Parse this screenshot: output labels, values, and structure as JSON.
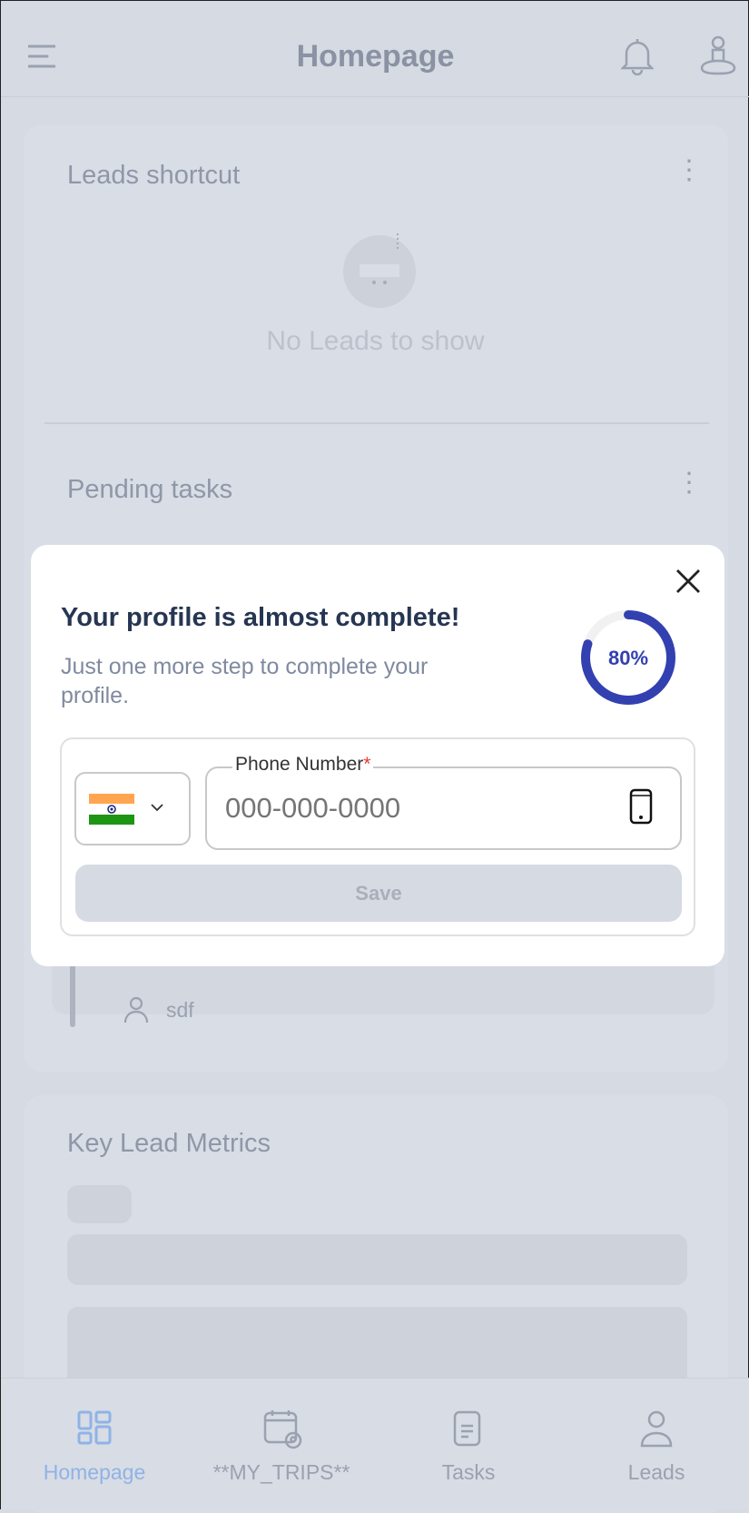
{
  "header": {
    "title": "Homepage",
    "menu_icon": "hamburger-menu-icon",
    "bell_icon": "bell-icon",
    "profile_icon": "user-location-icon"
  },
  "leads_shortcut": {
    "title": "Leads shortcut",
    "empty_text": "No Leads to show"
  },
  "pending_tasks": {
    "title": "Pending tasks",
    "task": {
      "assignee": "sdf"
    }
  },
  "key_metrics": {
    "title": "Key Lead Metrics"
  },
  "modal": {
    "title": "Your profile is almost complete!",
    "subtitle": "Just one more step to complete your profile.",
    "progress_percent": 80,
    "progress_label": "80%",
    "progress_color": "#3340b0",
    "country": "India",
    "phone_label": "Phone Number",
    "required_mark": "*",
    "phone_placeholder": "000-000-0000",
    "phone_value": "",
    "save_label": "Save"
  },
  "nav": {
    "active_color": "#8fb3e6",
    "items": [
      {
        "label": "Homepage",
        "icon": "dashboard-icon",
        "active": true
      },
      {
        "label": "**MY_TRIPS**",
        "icon": "calendar-location-icon"
      },
      {
        "label": "Tasks",
        "icon": "document-icon"
      },
      {
        "label": "Leads",
        "icon": "user-icon"
      }
    ]
  }
}
